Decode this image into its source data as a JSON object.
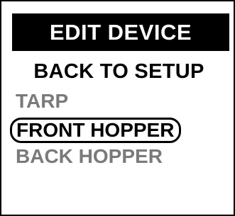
{
  "screen": {
    "title": "EDIT DEVICE",
    "menu": {
      "items": [
        {
          "label": "BACK TO SETUP",
          "state": "default"
        },
        {
          "label": "TARP",
          "state": "disabled"
        },
        {
          "label": "FRONT HOPPER",
          "state": "selected"
        },
        {
          "label": "BACK HOPPER",
          "state": "disabled"
        }
      ]
    }
  },
  "colors": {
    "background": "#ffffff",
    "title_background": "#000000",
    "title_text": "#ffffff",
    "active_text": "#000000",
    "inactive_text": "#7a7a7a",
    "selection_outline": "#000000"
  }
}
